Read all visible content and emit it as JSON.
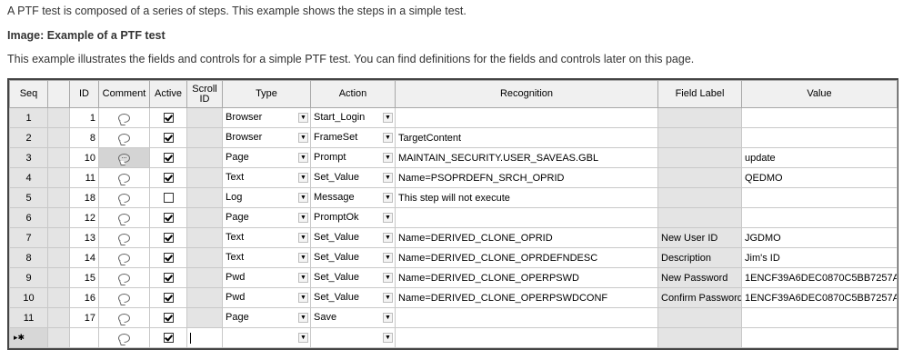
{
  "intro": "A PTF test is composed of a series of steps. This example shows the steps in a simple test.",
  "image_title": "Image: Example of a PTF test",
  "image_desc": "This example illustrates the fields and controls for a simple PTF test. You can find definitions for the fields and controls later on this page.",
  "columns": {
    "seq": "Seq",
    "id": "ID",
    "comment": "Comment",
    "active": "Active",
    "scroll_line1": "Scroll",
    "scroll_line2": "ID",
    "type": "Type",
    "action": "Action",
    "recognition": "Recognition",
    "field_label": "Field Label",
    "value": "Value"
  },
  "rows": [
    {
      "seq": "1",
      "id": "1",
      "comment_filled": false,
      "active": true,
      "type": "Browser",
      "action": "Start_Login",
      "recognition": "",
      "field_label": "",
      "value": ""
    },
    {
      "seq": "2",
      "id": "8",
      "comment_filled": false,
      "active": true,
      "type": "Browser",
      "action": "FrameSet",
      "recognition": "TargetContent",
      "field_label": "",
      "value": ""
    },
    {
      "seq": "3",
      "id": "10",
      "comment_filled": true,
      "active": true,
      "type": "Page",
      "action": "Prompt",
      "recognition": "MAINTAIN_SECURITY.USER_SAVEAS.GBL",
      "field_label": "",
      "value": "update"
    },
    {
      "seq": "4",
      "id": "11",
      "comment_filled": false,
      "active": true,
      "type": "Text",
      "action": "Set_Value",
      "recognition": "Name=PSOPRDEFN_SRCH_OPRID",
      "field_label": "",
      "value": "QEDMO"
    },
    {
      "seq": "5",
      "id": "18",
      "comment_filled": false,
      "active": false,
      "type": "Log",
      "action": "Message",
      "recognition": "This step will not execute",
      "field_label": "",
      "value": ""
    },
    {
      "seq": "6",
      "id": "12",
      "comment_filled": false,
      "active": true,
      "type": "Page",
      "action": "PromptOk",
      "recognition": "",
      "field_label": "",
      "value": ""
    },
    {
      "seq": "7",
      "id": "13",
      "comment_filled": false,
      "active": true,
      "type": "Text",
      "action": "Set_Value",
      "recognition": "Name=DERIVED_CLONE_OPRID",
      "field_label": "New User ID",
      "value": "JGDMO"
    },
    {
      "seq": "8",
      "id": "14",
      "comment_filled": false,
      "active": true,
      "type": "Text",
      "action": "Set_Value",
      "recognition": "Name=DERIVED_CLONE_OPRDEFNDESC",
      "field_label": "Description",
      "value": "Jim's ID"
    },
    {
      "seq": "9",
      "id": "15",
      "comment_filled": false,
      "active": true,
      "type": "Pwd",
      "action": "Set_Value",
      "recognition": "Name=DERIVED_CLONE_OPERPSWD",
      "field_label": "New Password",
      "value": "1ENCF39A6DEC0870C5BB7257A..."
    },
    {
      "seq": "10",
      "id": "16",
      "comment_filled": false,
      "active": true,
      "type": "Pwd",
      "action": "Set_Value",
      "recognition": "Name=DERIVED_CLONE_OPERPSWDCONF",
      "field_label": "Confirm Password",
      "value": "1ENCF39A6DEC0870C5BB7257A..."
    },
    {
      "seq": "11",
      "id": "17",
      "comment_filled": false,
      "active": true,
      "type": "Page",
      "action": "Save",
      "recognition": "",
      "field_label": "",
      "value": ""
    }
  ],
  "new_row": {
    "seq": "▸✱",
    "active": true
  },
  "icons": {
    "comment": "comment-bubble-icon",
    "dropdown": "dropdown-arrow-icon",
    "checkbox": "checkbox-icon"
  }
}
